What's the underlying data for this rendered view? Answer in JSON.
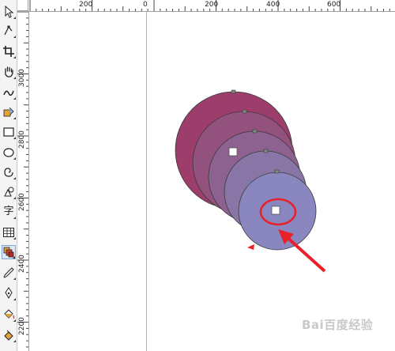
{
  "toolbox": {
    "tools": [
      {
        "name": "pick-tool",
        "icon": "pointer-arrow-icon"
      },
      {
        "name": "shape-tool",
        "icon": "shape-node-icon"
      },
      {
        "name": "crop-tool",
        "icon": "crop-icon"
      },
      {
        "name": "pan-tool",
        "icon": "hand-icon"
      },
      {
        "name": "freehand-tool",
        "icon": "freehand-curve-icon"
      },
      {
        "name": "smart-fill-tool",
        "icon": "smart-fill-icon"
      },
      {
        "name": "rectangle-tool",
        "icon": "rectangle-icon"
      },
      {
        "name": "ellipse-tool",
        "icon": "ellipse-icon"
      },
      {
        "name": "spiral-tool",
        "icon": "spiral-icon"
      },
      {
        "name": "basic-shapes-tool",
        "icon": "basic-shapes-icon"
      },
      {
        "name": "text-tool",
        "icon": "text-icon",
        "glyph": "字"
      },
      {
        "name": "table-tool",
        "icon": "table-icon"
      },
      {
        "name": "blend-tool",
        "icon": "blend-icon",
        "active": true
      },
      {
        "name": "eyedropper-tool",
        "icon": "eyedropper-icon"
      },
      {
        "name": "outline-pen-tool",
        "icon": "pen-nib-icon"
      },
      {
        "name": "fill-tool",
        "icon": "paint-bucket-icon"
      },
      {
        "name": "interactive-fill-tool",
        "icon": "interactive-fill-icon"
      }
    ]
  },
  "rulers": {
    "horizontal_labels": [
      "200",
      "0",
      "200",
      "400",
      "600"
    ],
    "vertical_labels": [
      "3000",
      "2800",
      "2600",
      "2400",
      "2200"
    ]
  },
  "canvas": {
    "circle_colors": [
      "#9c3d6c",
      "#93517e",
      "#8d6290",
      "#8a76a6",
      "#8a86bf"
    ],
    "annotation_color": "#e8202a",
    "watermark": "Bai百度经验"
  }
}
